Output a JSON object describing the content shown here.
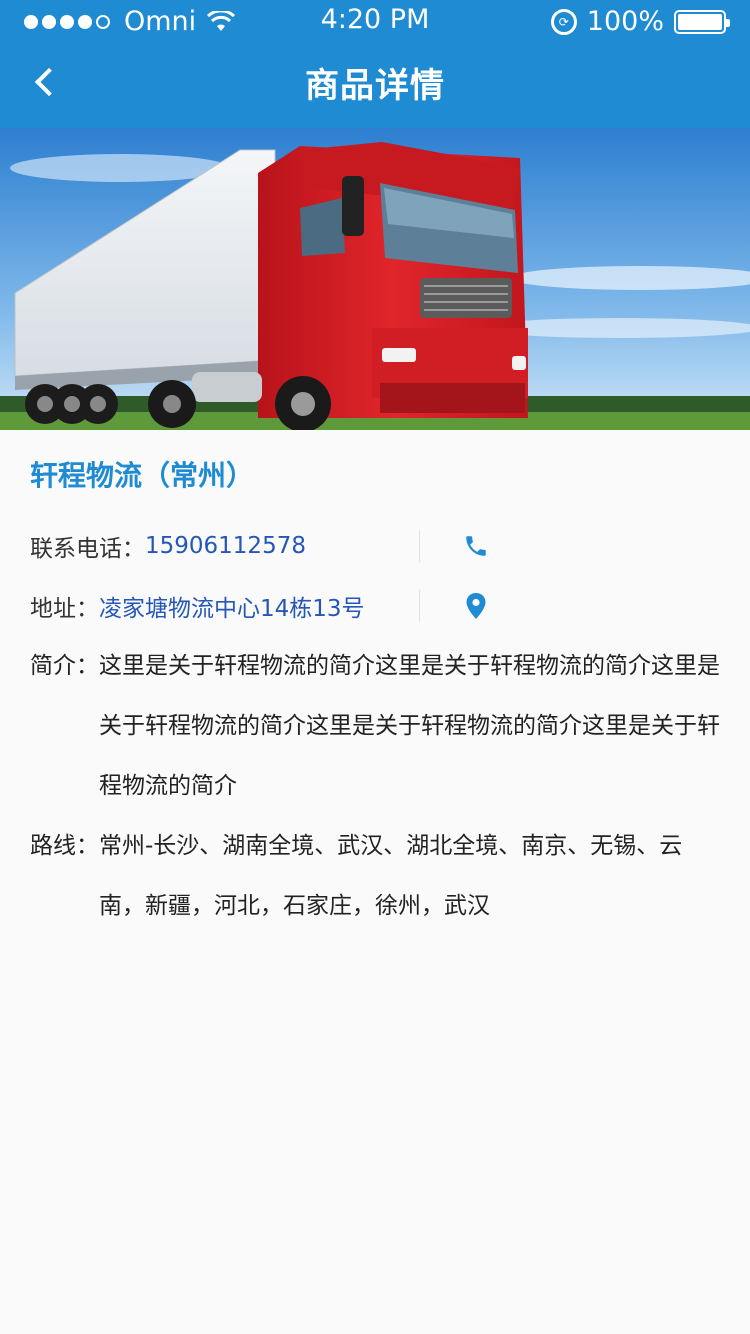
{
  "status_bar": {
    "carrier": "Omni",
    "time": "4:20 PM",
    "battery": "100%"
  },
  "nav": {
    "title": "商品详情",
    "back_icon": "chevron-left-icon"
  },
  "hero": {
    "description_icon": "truck-image"
  },
  "company": {
    "name": "轩程物流（常州）"
  },
  "contact": {
    "phone_label": "联系电话：",
    "phone": "15906112578",
    "phone_icon": "phone-icon",
    "address_label": "地址：",
    "address": "凌家塘物流中心14栋13号",
    "address_icon": "location-pin-icon"
  },
  "intro": {
    "label": "简介：",
    "text": "这里是关于轩程物流的简介这里是关于轩程物流的简介这里是关于轩程物流的简介这里是关于轩程物流的简介这里是关于轩程物流的简介"
  },
  "route": {
    "label": "路线：",
    "text": "常州-长沙、湖南全境、武汉、湖北全境、南京、无锡、云南，新疆，河北，石家庄，徐州，武汉"
  },
  "colors": {
    "accent": "#1f8bd2",
    "link": "#2457b8",
    "background": "#fafafa"
  }
}
